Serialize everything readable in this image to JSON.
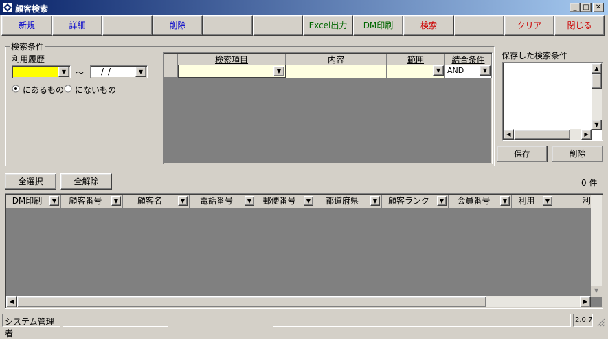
{
  "window": {
    "title": "顧客検索",
    "min": "_",
    "max": "□",
    "close": "✕"
  },
  "toolbar": {
    "new": "新規",
    "detail": "詳細",
    "delete": "削除",
    "excel": "Excel出力",
    "dm_print": "DM印刷",
    "search": "検索",
    "clear": "クリア",
    "close": "閉じる"
  },
  "colors": {
    "blue_label": "#0000cc",
    "green_label": "#006600",
    "red_label": "#cc0000",
    "highlight_yellow": "#ffff00",
    "cell_cream": "#ffffe1"
  },
  "conditions": {
    "legend": "検索条件",
    "usage_history_label": "利用履歴",
    "date_from": "____",
    "tilde": "～",
    "date_to": "__/_/_",
    "radio_has": "にあるもの",
    "radio_hasnot": "にないもの",
    "grid_headers": {
      "item": "検索項目",
      "content": "内容",
      "range": "範囲",
      "combine": "結合条件"
    },
    "row_combine_value": "AND"
  },
  "saved": {
    "label": "保存した検索条件",
    "save_btn": "保存",
    "delete_btn": "削除"
  },
  "results": {
    "select_all": "全選択",
    "deselect_all": "全解除",
    "count": "0 件",
    "columns": [
      "DM印刷",
      "顧客番号",
      "顧客名",
      "電話番号",
      "郵便番号",
      "都道府県",
      "顧客ランク",
      "会員番号",
      "利用",
      "利用"
    ]
  },
  "status": {
    "user": "システム管理者",
    "version": "2.0.7"
  }
}
